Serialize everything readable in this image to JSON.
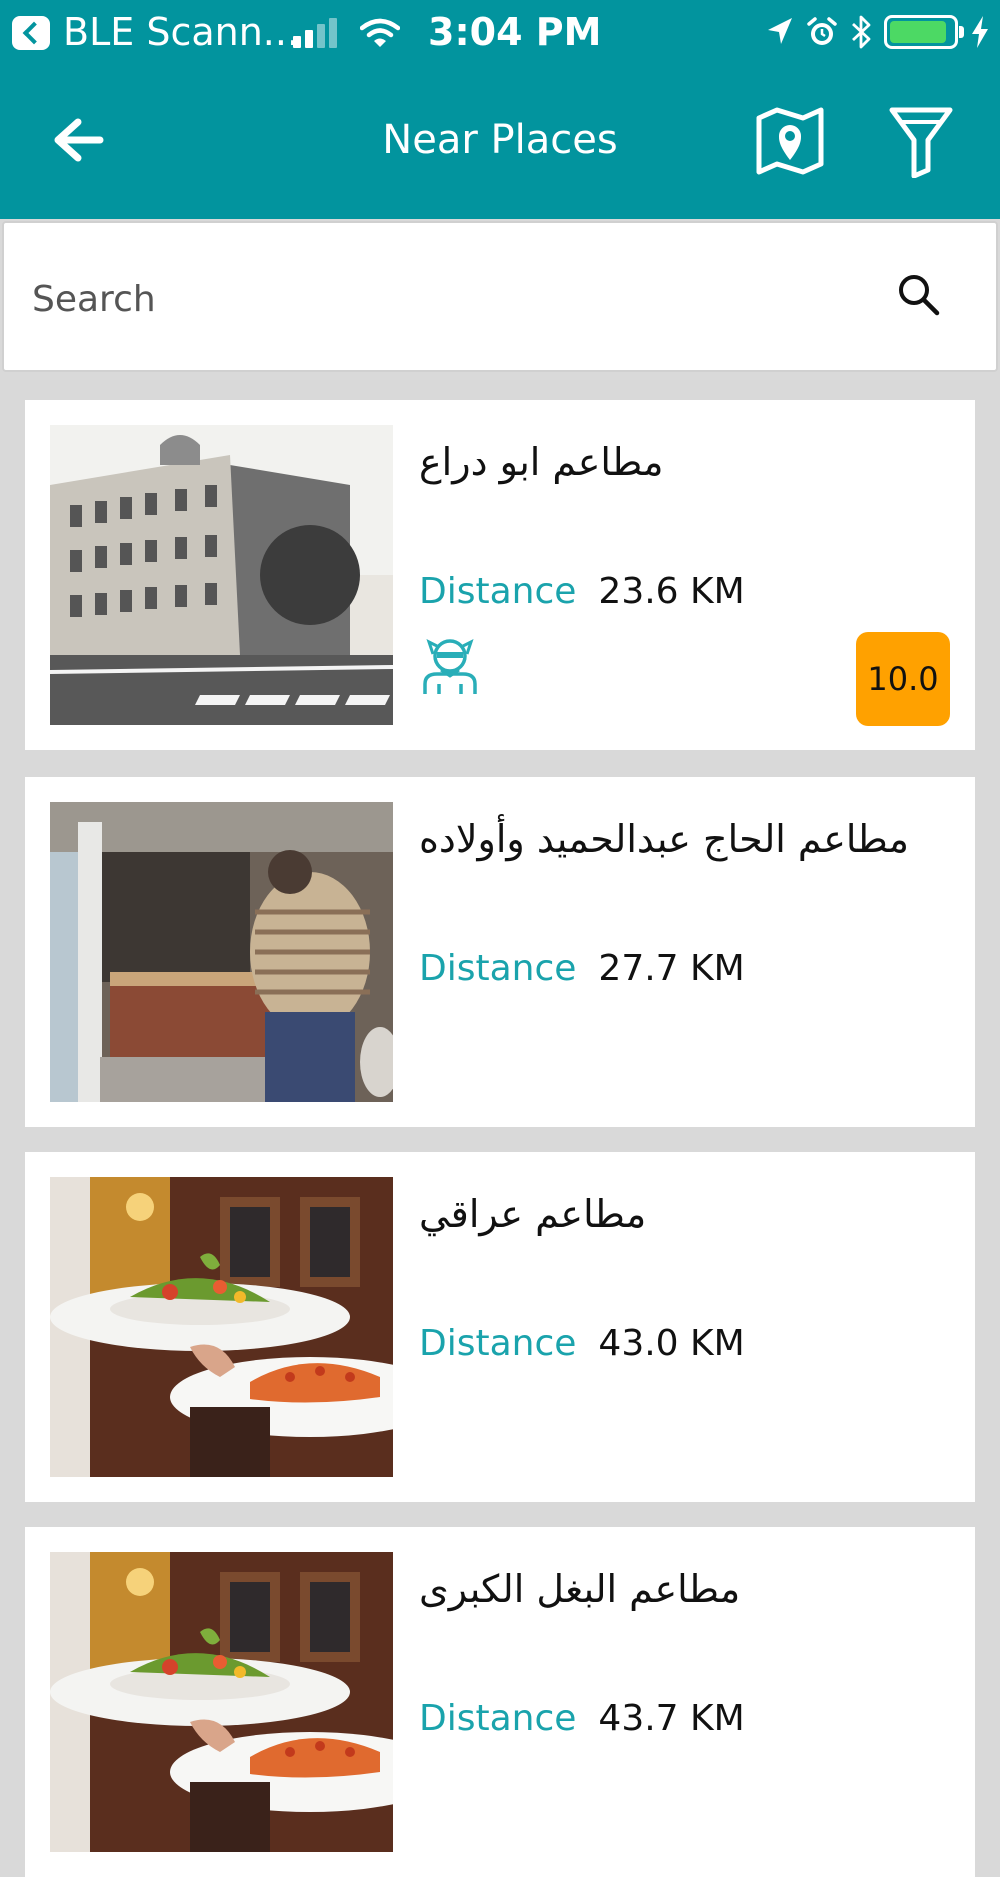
{
  "status_bar": {
    "app_name": "BLE Scann...",
    "time": "3:04 PM",
    "battery_level": 0.9
  },
  "nav": {
    "title": "Near Places"
  },
  "search": {
    "placeholder": "Search"
  },
  "places": [
    {
      "name": "مطاعم ابو دراع",
      "distance_label": "Distance",
      "distance": "23.6 KM",
      "rating": "10.0",
      "has_badge_icon": true,
      "image": "building-photo"
    },
    {
      "name": "مطاعم الحاج عبدالحميد وأولاده",
      "distance_label": "Distance",
      "distance": "27.7 KM",
      "image": "food-stall-photo"
    },
    {
      "name": "مطاعم عراقي",
      "distance_label": "Distance",
      "distance": "43.0 KM",
      "image": "waiter-plates-photo"
    },
    {
      "name": "مطاعم البغل الكبرى",
      "distance_label": "Distance",
      "distance": "43.7 KM",
      "image": "waiter-plates-photo"
    }
  ],
  "colors": {
    "header": "#02949e",
    "accent": "#1aa3ac",
    "rating": "#ffa100",
    "background": "#d9d9d9"
  }
}
